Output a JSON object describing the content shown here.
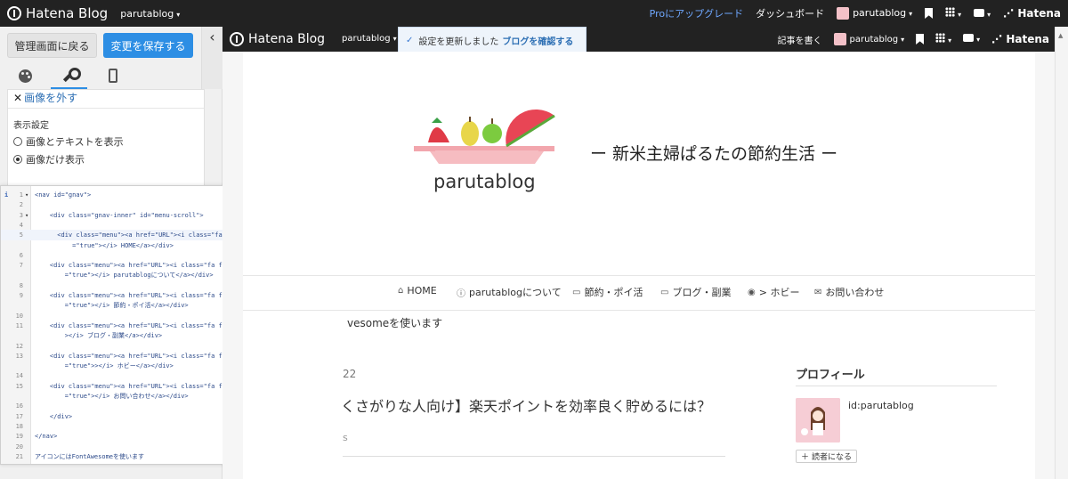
{
  "topbar": {
    "brand": "Hatena Blog",
    "blog_name": "parutablog",
    "pro_link": "Proにアップグレード",
    "dashboard": "ダッシュボード",
    "user": "parutablog",
    "hatena": "Hatena"
  },
  "sidebar": {
    "back_button": "管理画面に戻る",
    "save_button": "変更を保存する",
    "collapse_glyph": "‹",
    "remove_image": "画像を外す",
    "display_settings": "表示設定",
    "option_image_text": "画像とテキストを表示",
    "option_image_only": "画像だけ表示",
    "selected_option": "画像だけ表示"
  },
  "editor": {
    "lines": [
      {
        "n": "1",
        "fold": true,
        "text": "<nav id=\"gnav\">"
      },
      {
        "n": "2",
        "text": ""
      },
      {
        "n": "3",
        "fold": true,
        "text": "    <div class=\"gnav-inner\" id=\"menu-scroll\">"
      },
      {
        "n": "4",
        "text": ""
      },
      {
        "n": "5",
        "text": "      <div class=\"menu\"><a href=\"URL\"><i class=\"fa fa-home\" aria-hidden"
      },
      {
        "n": "",
        "text": "          =\"true\"></i> HOME</a></div>"
      },
      {
        "n": "6",
        "text": ""
      },
      {
        "n": "7",
        "text": "    <div class=\"menu\"><a href=\"URL\"><i class=\"fa fa-info-circle\" aria-hidden"
      },
      {
        "n": "",
        "text": "        =\"true\"></i> parutablogについて</a></div>"
      },
      {
        "n": "8",
        "text": ""
      },
      {
        "n": "9",
        "text": "    <div class=\"menu\"><a href=\"URL\"><i class=\"fa fa-credit-card\" aria-hidden"
      },
      {
        "n": "",
        "text": "        =\"true\"></i> 節約・ポイ活</a></div>"
      },
      {
        "n": "10",
        "text": ""
      },
      {
        "n": "11",
        "text": "    <div class=\"menu\"><a href=\"URL\"><i class=\"fa fa-laptop\" aria-hidden=\"true\""
      },
      {
        "n": "",
        "text": "        ></i> ブログ・副業</a></div>"
      },
      {
        "n": "12",
        "text": ""
      },
      {
        "n": "13",
        "text": "    <div class=\"menu\"><a href=\"URL\"><i class=\"fa fa-gamepad\" aria-hidden"
      },
      {
        "n": "",
        "text": "        =\"true\">></i> ホビー</a></div>"
      },
      {
        "n": "14",
        "text": ""
      },
      {
        "n": "15",
        "text": "    <div class=\"menu\"><a href=\"URL\"><i class=\"fa fa-envelope-o\" aria-hidden"
      },
      {
        "n": "",
        "text": "        =\"true\"></i> お問い合わせ</a></div>"
      },
      {
        "n": "16",
        "text": ""
      },
      {
        "n": "17",
        "text": "    </div>"
      },
      {
        "n": "18",
        "text": ""
      },
      {
        "n": "19",
        "text": "</nav>"
      },
      {
        "n": "20",
        "text": ""
      },
      {
        "n": "21",
        "text": "アイコンにはFontAwesomeを使います"
      }
    ],
    "active_line": "5"
  },
  "preview": {
    "brand": "Hatena Blog",
    "blog_name": "parutablog",
    "write_post": "記事を書く",
    "user": "parutablog",
    "hatena": "Hatena",
    "toast_text": "設定を更新しました",
    "toast_link": "ブログを確認する",
    "logo_text": "parutablog",
    "tagline": "ー 新米主婦ぱるたの節約生活 ー",
    "gnav": [
      {
        "icon": "home-icon",
        "glyph": "⌂",
        "label": "HOME"
      },
      {
        "icon": "info-circle-icon",
        "glyph": "ⓘ",
        "label": "parutablogについて"
      },
      {
        "icon": "credit-card-icon",
        "glyph": "▭",
        "label": "節約・ポイ活"
      },
      {
        "icon": "laptop-icon",
        "glyph": "▭",
        "label": "ブログ・副業"
      },
      {
        "icon": "gamepad-icon",
        "glyph": "◉",
        "label": "> ホビー"
      },
      {
        "icon": "envelope-icon",
        "glyph": "✉",
        "label": "お問い合わせ"
      }
    ],
    "notice_partial": "vesomeを使います",
    "entry_date_partial": "22",
    "entry_title_partial": "くさがりな人向け】楽天ポイントを効率良く貯めるには？",
    "entry_meta_partial": "s",
    "profile_heading": "プロフィール",
    "profile_id": "id:parutablog",
    "reader_button": "読者になる"
  },
  "colors": {
    "accent": "#2d8ee4",
    "topbar": "#222222",
    "pro_link": "#6fa8ff",
    "toast_bg": "#eef4fb"
  }
}
